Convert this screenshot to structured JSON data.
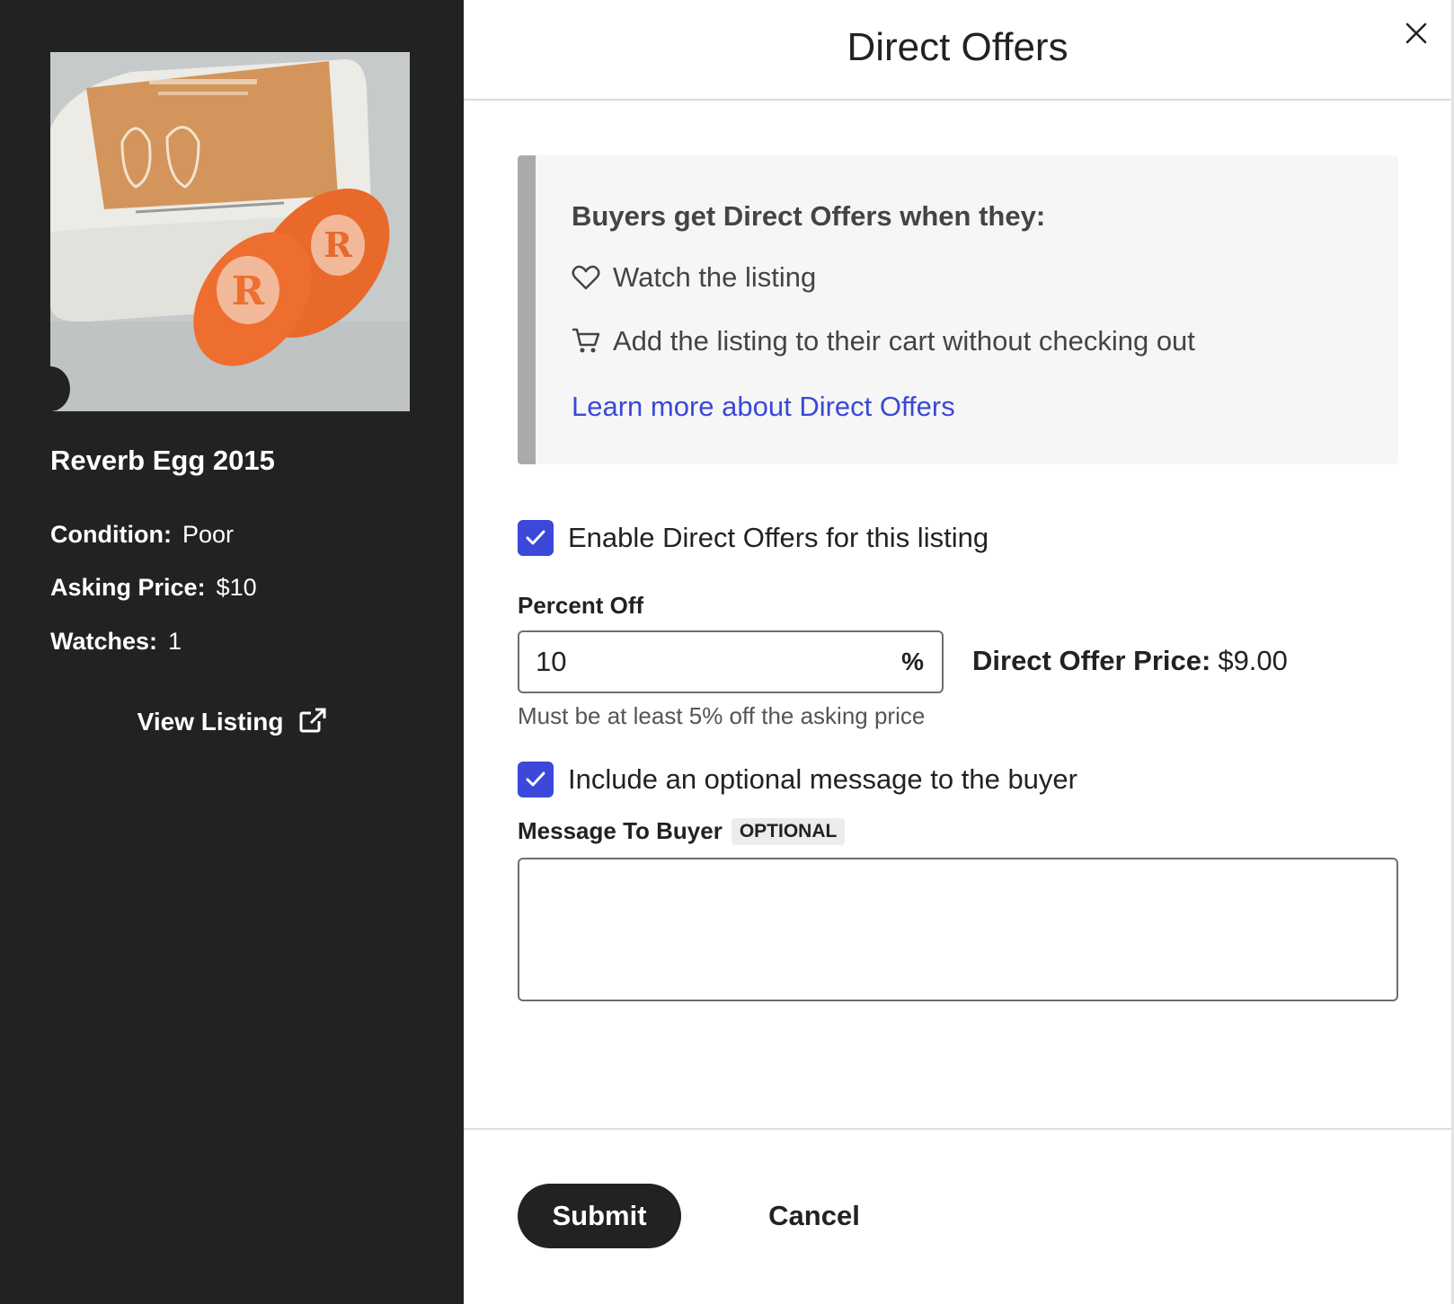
{
  "modal": {
    "title": "Direct Offers"
  },
  "listing": {
    "title": "Reverb Egg 2015",
    "condition_label": "Condition:",
    "condition_value": "Poor",
    "price_label": "Asking Price:",
    "price_value": "$10",
    "watches_label": "Watches:",
    "watches_value": "1",
    "view_listing_label": "View Listing"
  },
  "info": {
    "heading": "Buyers get Direct Offers when they:",
    "items": [
      {
        "icon": "heart-icon",
        "text": "Watch the listing"
      },
      {
        "icon": "cart-icon",
        "text": "Add the listing to their cart without checking out"
      }
    ],
    "link_text": "Learn more about Direct Offers"
  },
  "form": {
    "enable_label": "Enable Direct Offers for this listing",
    "enable_checked": true,
    "percent_label": "Percent Off",
    "percent_value": "10",
    "percent_suffix": "%",
    "offer_price_label": "Direct Offer Price:",
    "offer_price_value": "$9.00",
    "helper_text": "Must be at least 5% off the asking price",
    "message_toggle_label": "Include an optional message to the buyer",
    "message_toggle_checked": true,
    "message_label": "Message To Buyer",
    "message_badge": "OPTIONAL",
    "message_value": ""
  },
  "footer": {
    "submit_label": "Submit",
    "cancel_label": "Cancel"
  },
  "colors": {
    "accent": "#3b48d9",
    "sidebar_bg": "#222222",
    "info_bg": "#f6f6f6",
    "info_bar": "#aaaaaa"
  }
}
